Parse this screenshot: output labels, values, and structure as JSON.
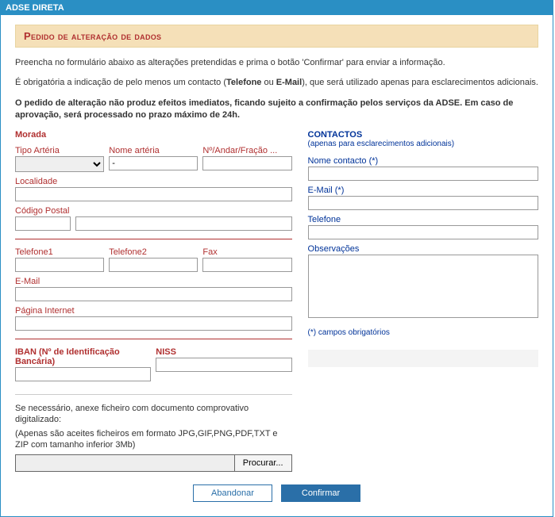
{
  "app": {
    "title": "ADSE DIRETA"
  },
  "section": {
    "title": "Pedido de alteração de dados"
  },
  "intro": {
    "p1": "Preencha no formulário abaixo as alterações pretendidas e prima o botão 'Confirmar' para enviar a informação.",
    "p2_a": "É obrigatória a indicação de pelo menos um contacto (",
    "p2_b": "Telefone",
    "p2_c": " ou ",
    "p2_d": "E-Mail",
    "p2_e": "), que será utilizado apenas para esclarecimentos adicionais.",
    "p3": "O pedido de alteração não produz efeitos imediatos, ficando sujeito a confirmação pelos serviços da ADSE. Em caso de aprovação, será processado no prazo máximo de 24h."
  },
  "morada": {
    "title": "Morada",
    "tipo_arteria": "Tipo Artéria",
    "nome_arteria": "Nome artéria",
    "numero": "Nº/Andar/Fração ...",
    "localidade": "Localidade",
    "codigo_postal": "Código Postal",
    "telefone1": "Telefone1",
    "telefone2": "Telefone2",
    "fax": "Fax",
    "email": "E-Mail",
    "pagina": "Página Internet",
    "iban": "IBAN (Nº de Identificação Bancária)",
    "niss": "NISS",
    "nome_arteria_value": "-"
  },
  "upload": {
    "line1": "Se necessário, anexe ficheiro com documento comprovativo digitalizado:",
    "line2": "(Apenas são aceites ficheiros em formato JPG,GIF,PNG,PDF,TXT e ZIP com tamanho inferior 3Mb)",
    "browse": "Procurar..."
  },
  "contactos": {
    "title": "CONTACTOS",
    "sub": "(apenas para esclarecimentos adicionais)",
    "nome": "Nome contacto (*)",
    "email": "E-Mail (*)",
    "telefone": "Telefone",
    "obs": "Observações",
    "note": "(*) campos obrigatórios"
  },
  "actions": {
    "abandon": "Abandonar",
    "confirm": "Confirmar"
  }
}
